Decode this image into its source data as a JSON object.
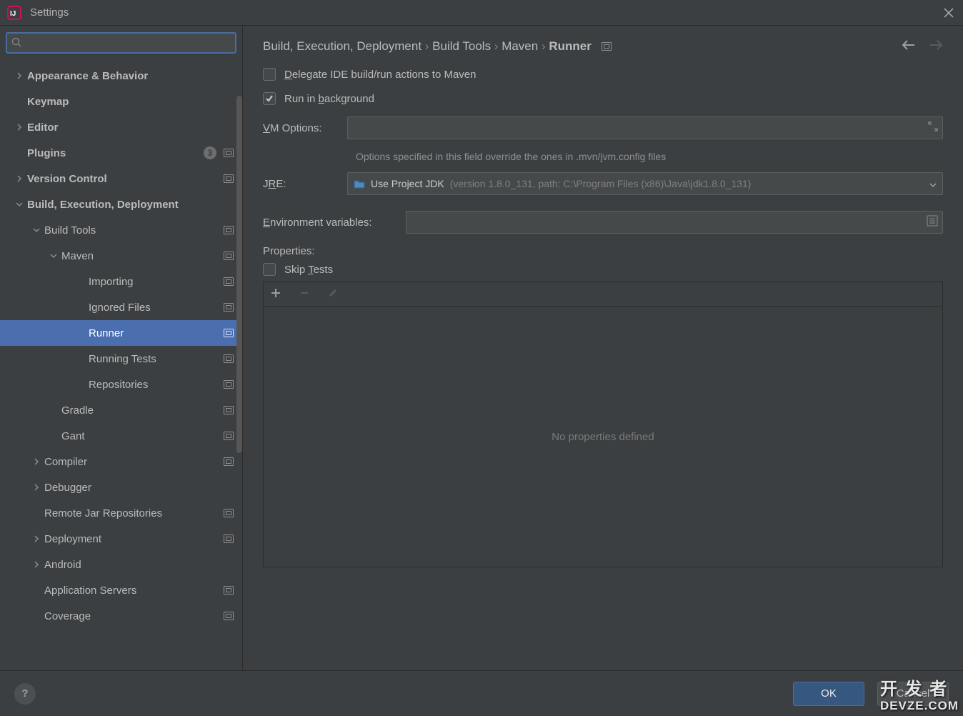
{
  "window": {
    "title": "Settings"
  },
  "search": {
    "placeholder": ""
  },
  "sidebar": [
    {
      "label": "Appearance & Behavior",
      "indent": 0,
      "bold": true,
      "chev": "right"
    },
    {
      "label": "Keymap",
      "indent": 0,
      "bold": true
    },
    {
      "label": "Editor",
      "indent": 0,
      "bold": true,
      "chev": "right"
    },
    {
      "label": "Plugins",
      "indent": 0,
      "bold": true,
      "badge": "3",
      "scope": true
    },
    {
      "label": "Version Control",
      "indent": 0,
      "bold": true,
      "chev": "right",
      "scope": true
    },
    {
      "label": "Build, Execution, Deployment",
      "indent": 0,
      "bold": true,
      "chev": "down"
    },
    {
      "label": "Build Tools",
      "indent": 1,
      "chev": "down",
      "scope": true
    },
    {
      "label": "Maven",
      "indent": 2,
      "chev": "down",
      "scope": true
    },
    {
      "label": "Importing",
      "indent": 3,
      "scope": true
    },
    {
      "label": "Ignored Files",
      "indent": 3,
      "scope": true
    },
    {
      "label": "Runner",
      "indent": 3,
      "scope": true,
      "selected": true
    },
    {
      "label": "Running Tests",
      "indent": 3,
      "scope": true
    },
    {
      "label": "Repositories",
      "indent": 3,
      "scope": true
    },
    {
      "label": "Gradle",
      "indent": 2,
      "scope": true
    },
    {
      "label": "Gant",
      "indent": 2,
      "scope": true
    },
    {
      "label": "Compiler",
      "indent": 1,
      "chev": "right",
      "scope": true
    },
    {
      "label": "Debugger",
      "indent": 1,
      "chev": "right"
    },
    {
      "label": "Remote Jar Repositories",
      "indent": 1,
      "scope": true
    },
    {
      "label": "Deployment",
      "indent": 1,
      "chev": "right",
      "scope": true
    },
    {
      "label": "Android",
      "indent": 1,
      "chev": "right"
    },
    {
      "label": "Application Servers",
      "indent": 1,
      "scope": true
    },
    {
      "label": "Coverage",
      "indent": 1,
      "scope": true
    }
  ],
  "breadcrumbs": [
    "Build, Execution, Deployment",
    "Build Tools",
    "Maven",
    "Runner"
  ],
  "form": {
    "delegate_label": "Delegate IDE build/run actions to Maven",
    "delegate_checked": false,
    "background_label": "Run in background",
    "background_checked": true,
    "vm_label": "VM Options:",
    "vm_value": "",
    "vm_hint": "Options specified in this field override the ones in .mvn/jvm.config files",
    "jre_label": "JRE:",
    "jre_main": "Use Project JDK",
    "jre_sub": "(version 1.8.0_131, path: C:\\Program Files (x86)\\Java\\jdk1.8.0_131)",
    "env_label": "Environment variables:",
    "env_value": "",
    "properties_label": "Properties:",
    "skip_tests_label": "Skip Tests",
    "skip_tests_checked": false,
    "properties_empty": "No properties defined"
  },
  "footer": {
    "ok": "OK",
    "cancel": "Cancel"
  },
  "watermark": {
    "line1": "开 发 者",
    "line2": "DEVZE.COM"
  }
}
